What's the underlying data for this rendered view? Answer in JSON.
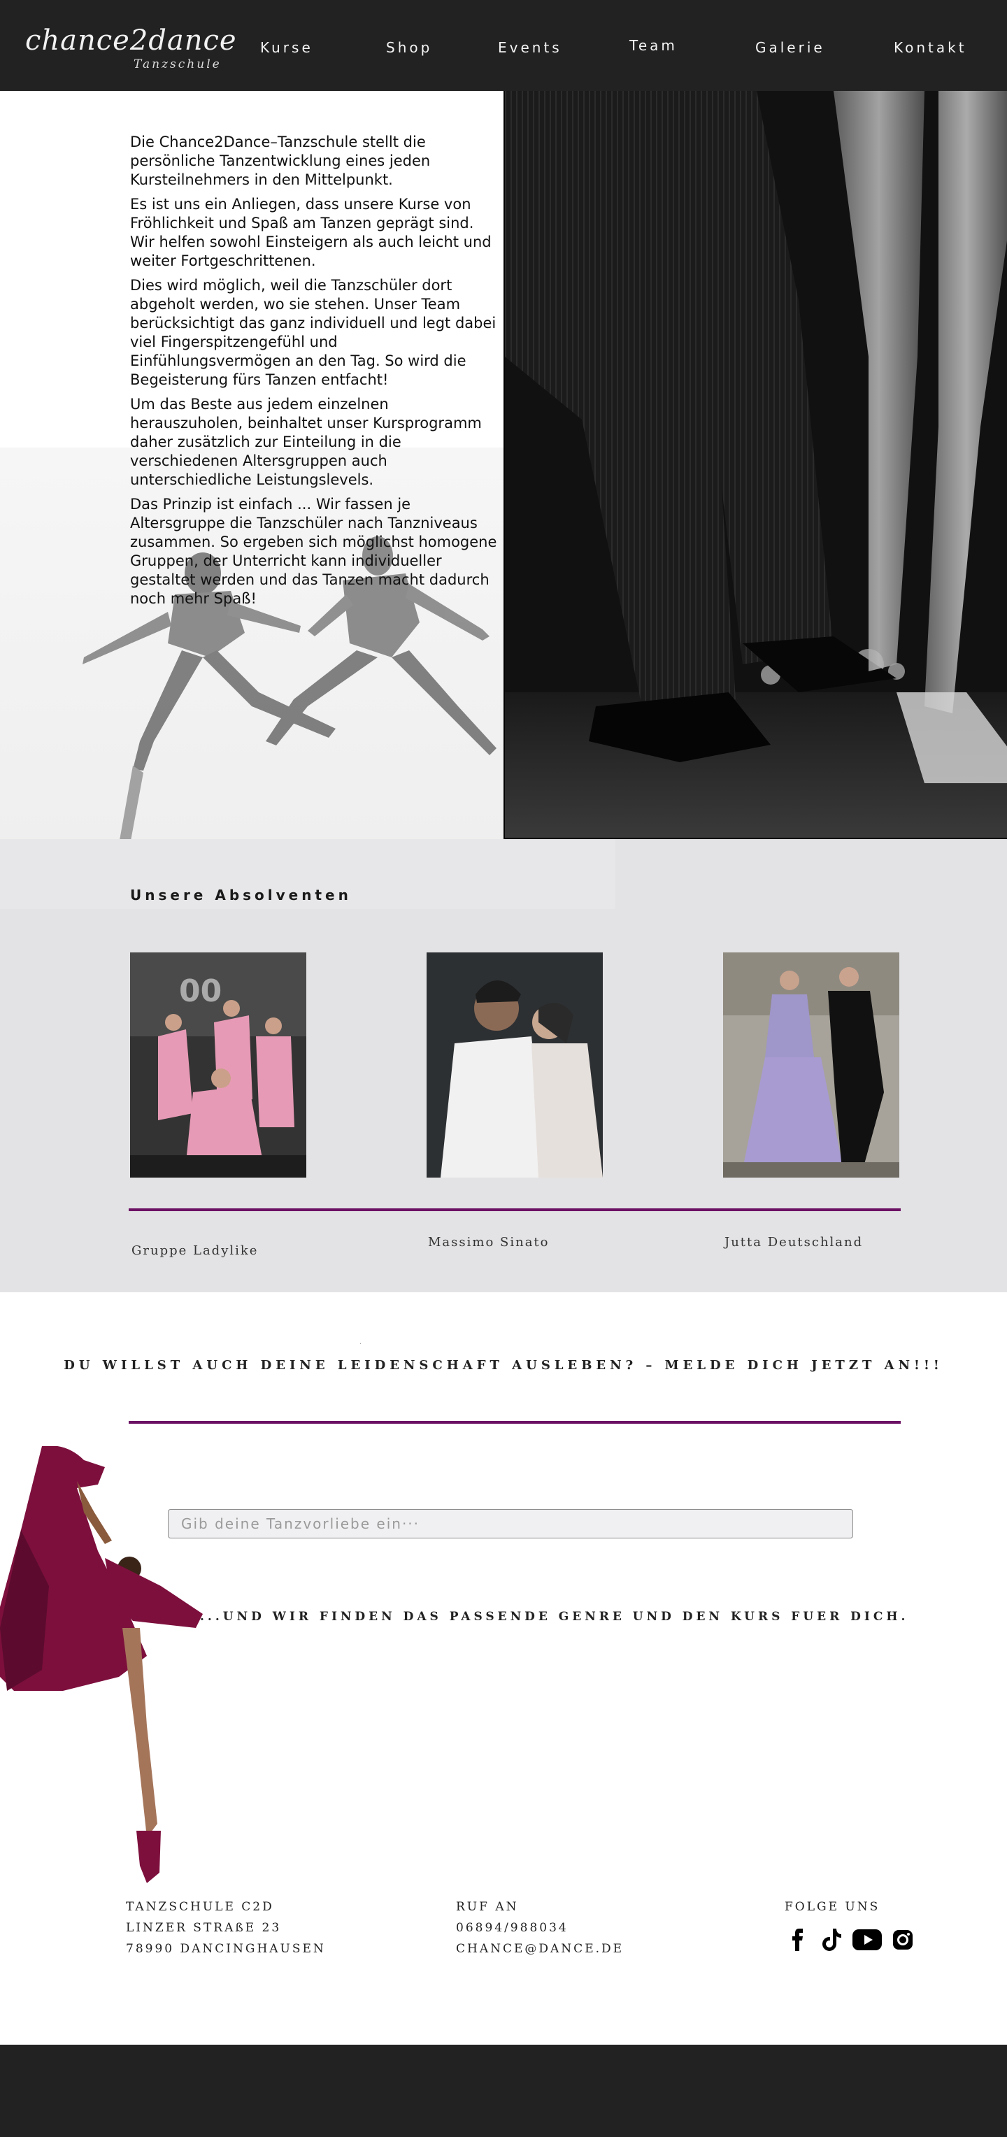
{
  "brand": {
    "name": "chance2dance",
    "subtitle": "Tanzschule"
  },
  "nav": {
    "items": [
      "Kurse",
      "Shop",
      "Events",
      "Team",
      "Galerie",
      "Kontakt"
    ]
  },
  "hero": {
    "paragraphs": [
      "Die Chance2Dance–Tanzschule stellt die persönliche Tanzentwicklung eines jeden Kursteilnehmers in den Mittelpunkt.",
      "Es ist uns ein Anliegen, dass unsere Kurse von Fröhlichkeit und Spaß am Tanzen geprägt sind. Wir helfen sowohl Einsteigern als auch leicht und weiter Fortgeschrittenen.",
      "Dies wird möglich, weil die Tanzschüler dort abgeholt werden, wo sie stehen. Unser Team berücksichtigt das ganz individuell und legt dabei viel Fingerspitzengefühl und Einfühlungsvermögen an den Tag. So wird die Begeisterung fürs Tanzen entfacht!",
      "Um das Beste aus jedem einzelnen herauszuholen, beinhaltet unser Kursprogramm daher zusätzlich zur Einteilung in die verschiedenen Altersgruppen auch unterschiedliche Leistungslevels.",
      "Das Prinzip ist einfach ... Wir fassen je Altersgruppe die Tanzschüler nach Tanzniveaus zusammen. So ergeben sich möglichst homogene Gruppen, der Unterricht kann individueller gestaltet werden und das Tanzen macht dadurch noch mehr Spaß!"
    ]
  },
  "graduates": {
    "title": "Unsere Absolventen",
    "items": [
      {
        "name": "Gruppe Ladylike"
      },
      {
        "name": "Massimo Sinato"
      },
      {
        "name": "Jutta Deutschland"
      }
    ]
  },
  "cta": {
    "dot": ".",
    "title": "DU WILLST AUCH DEINE LEIDENSCHAFT AUSLEBEN? – MELDE DICH JETZT AN!!!",
    "search_placeholder": "Gib deine Tanzvorliebe ein···",
    "subtitle": "...UND WIR FINDEN DAS PASSENDE GENRE UND DEN KURS FUER DICH."
  },
  "footer": {
    "address": [
      "TANZSCHULE C2D",
      "LINZER STRAßE 23",
      "78990 DANCINGHAUSEN"
    ],
    "contact": [
      "RUF AN",
      "06894/988034",
      "CHANCE@DANCE.DE"
    ],
    "social_title": "FOLGE UNS",
    "social_icons": [
      "facebook-icon",
      "tiktok-icon",
      "youtube-icon",
      "instagram-icon"
    ]
  },
  "colors": {
    "dark": "#222222",
    "accent": "#6c1264",
    "grey_band": "#e3e3e5"
  }
}
